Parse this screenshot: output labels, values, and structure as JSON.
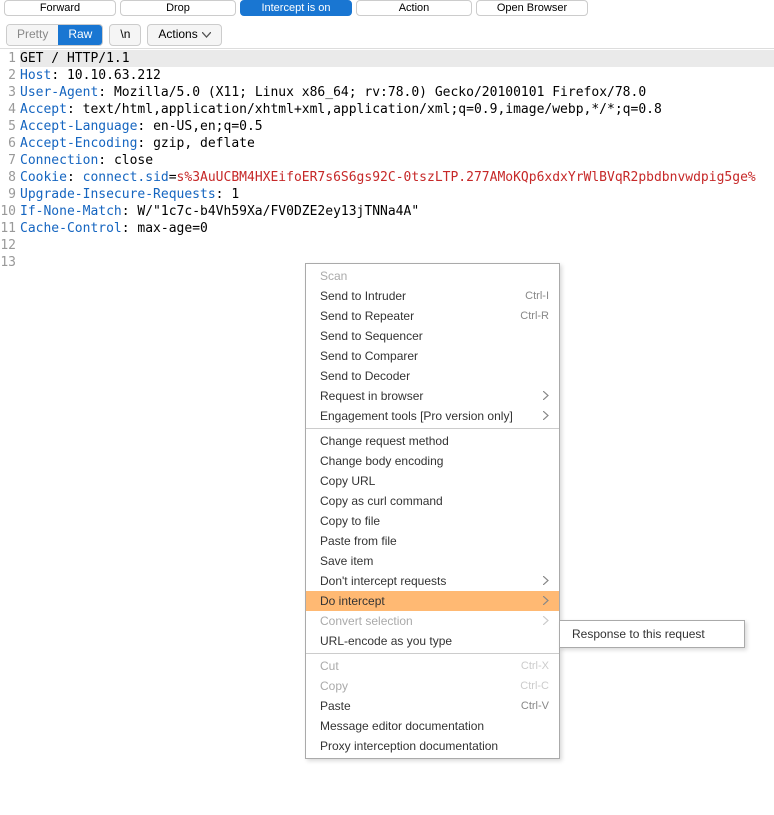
{
  "toolbar": {
    "forward": "Forward",
    "drop": "Drop",
    "intercept": "Intercept is on",
    "action": "Action",
    "open_browser": "Open Browser"
  },
  "tabs": {
    "pretty": "Pretty",
    "raw": "Raw",
    "newline": "\\n",
    "actions": "Actions"
  },
  "request": {
    "lines": [
      {
        "n": 1,
        "type": "req",
        "text": "GET / HTTP/1.1"
      },
      {
        "n": 2,
        "type": "hdr",
        "name": "Host",
        "value": "10.10.63.212"
      },
      {
        "n": 3,
        "type": "hdr",
        "name": "User-Agent",
        "value": "Mozilla/5.0 (X11; Linux x86_64; rv:78.0) Gecko/20100101 Firefox/78.0"
      },
      {
        "n": 4,
        "type": "hdr",
        "name": "Accept",
        "value": "text/html,application/xhtml+xml,application/xml;q=0.9,image/webp,*/*;q=0.8"
      },
      {
        "n": 5,
        "type": "hdr",
        "name": "Accept-Language",
        "value": "en-US,en;q=0.5"
      },
      {
        "n": 6,
        "type": "hdr",
        "name": "Accept-Encoding",
        "value": "gzip, deflate"
      },
      {
        "n": 7,
        "type": "hdr",
        "name": "Connection",
        "value": "close"
      },
      {
        "n": 8,
        "type": "cookie",
        "name": "Cookie",
        "key": "connect.sid",
        "val": "s%3AuUCBM4HXEifoER7s6S6gs92C-0tszLTP.277AMoKQp6xdxYrWlBVqR2pbdbnvwdpig5ge%"
      },
      {
        "n": 9,
        "type": "hdr",
        "name": "Upgrade-Insecure-Requests",
        "value": "1"
      },
      {
        "n": 10,
        "type": "hdr",
        "name": "If-None-Match",
        "value": "W/\"1c7c-b4Vh59Xa/FV0DZE2ey13jTNNa4A\""
      },
      {
        "n": 11,
        "type": "hdr",
        "name": "Cache-Control",
        "value": "max-age=0"
      },
      {
        "n": 12,
        "type": "empty"
      },
      {
        "n": 13,
        "type": "empty"
      }
    ]
  },
  "menu": {
    "sections": [
      [
        {
          "label": "Scan",
          "disabled": true
        },
        {
          "label": "Send to Intruder",
          "shortcut": "Ctrl-I"
        },
        {
          "label": "Send to Repeater",
          "shortcut": "Ctrl-R"
        },
        {
          "label": "Send to Sequencer"
        },
        {
          "label": "Send to Comparer"
        },
        {
          "label": "Send to Decoder"
        },
        {
          "label": "Request in browser",
          "arrow": true
        },
        {
          "label": "Engagement tools [Pro version only]",
          "arrow": true
        }
      ],
      [
        {
          "label": "Change request method"
        },
        {
          "label": "Change body encoding"
        },
        {
          "label": "Copy URL"
        },
        {
          "label": "Copy as curl command"
        },
        {
          "label": "Copy to file"
        },
        {
          "label": "Paste from file"
        },
        {
          "label": "Save item"
        },
        {
          "label": "Don't intercept requests",
          "arrow": true
        },
        {
          "label": "Do intercept",
          "arrow": true,
          "hover": true
        },
        {
          "label": "Convert selection",
          "disabled": true,
          "arrow": true
        },
        {
          "label": "URL-encode as you type"
        }
      ],
      [
        {
          "label": "Cut",
          "disabled": true,
          "shortcut": "Ctrl-X"
        },
        {
          "label": "Copy",
          "disabled": true,
          "shortcut": "Ctrl-C"
        },
        {
          "label": "Paste",
          "shortcut": "Ctrl-V"
        },
        {
          "label": "Message editor documentation"
        },
        {
          "label": "Proxy interception documentation"
        }
      ]
    ]
  },
  "submenu": {
    "items": [
      {
        "label": "Response to this request"
      }
    ]
  }
}
